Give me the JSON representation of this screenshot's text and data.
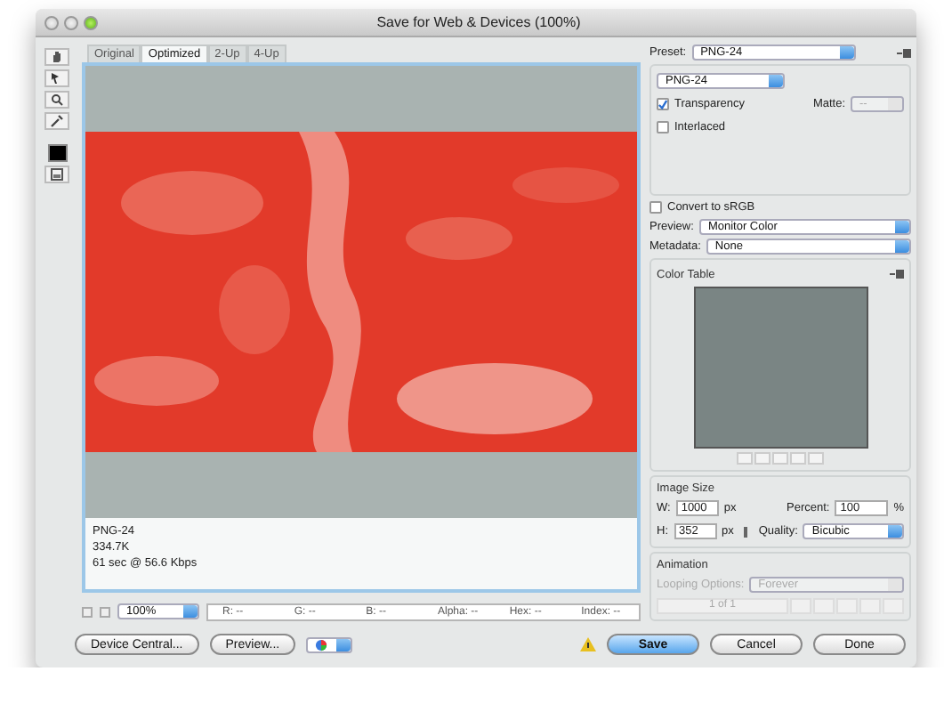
{
  "window": {
    "title": "Save for Web & Devices (100%)"
  },
  "tabs": [
    {
      "label": "Original",
      "selected": false
    },
    {
      "label": "Optimized",
      "selected": true
    },
    {
      "label": "2-Up",
      "selected": false
    },
    {
      "label": "4-Up",
      "selected": false
    }
  ],
  "preview": {
    "info": [
      "PNG-24",
      "334.7K",
      "61 sec @ 56.6 Kbps"
    ]
  },
  "status_bar": {
    "zoom": "100%",
    "readouts": [
      "R: --",
      "G: --",
      "B: --",
      "Alpha: --",
      "Hex: --",
      "Index: --"
    ]
  },
  "settings": {
    "preset": {
      "label": "Preset:",
      "value": "PNG-24"
    },
    "format": "PNG-24",
    "options": [
      {
        "label": "Transparency",
        "checked": true
      },
      {
        "label": "Interlaced",
        "checked": false
      }
    ],
    "matte": {
      "label": "Matte:",
      "value": "--",
      "disabled": true
    },
    "convert": {
      "label": "Convert to sRGB",
      "checked": false
    },
    "selects": [
      {
        "label": "Preview:",
        "value": "Monitor Color"
      },
      {
        "label": "Metadata:",
        "value": "None"
      }
    ]
  },
  "color_table": {
    "title": "Color Table"
  },
  "image_size": {
    "title": "Image Size",
    "width": {
      "label": "W:",
      "value": "1000",
      "unit": "px"
    },
    "height": {
      "label": "H:",
      "value": "352",
      "unit": "px"
    },
    "percent": {
      "label": "Percent:",
      "value": "100",
      "unit": "%"
    },
    "quality": {
      "label": "Quality:",
      "value": "Bicubic"
    }
  },
  "animation": {
    "title": "Animation",
    "disabled": true,
    "looping": {
      "label": "Looping Options:",
      "value": "Forever"
    },
    "frame": "1 of 1"
  },
  "left_buttons": [
    "Device Central...",
    "Preview..."
  ],
  "actions": [
    {
      "label": "Save",
      "kind": "primary"
    },
    {
      "label": "Cancel",
      "kind": "normal"
    },
    {
      "label": "Done",
      "kind": "normal"
    }
  ]
}
